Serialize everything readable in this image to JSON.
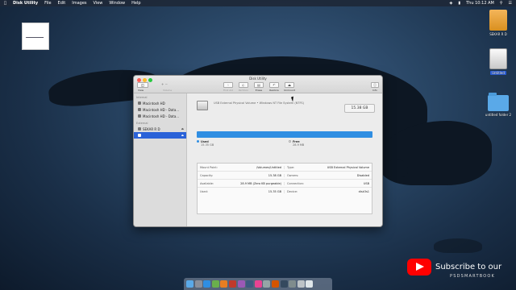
{
  "menubar": {
    "app": "Disk Utility",
    "items": [
      "File",
      "Edit",
      "Images",
      "View",
      "Window",
      "Help"
    ],
    "time": "Thu 10:12 AM"
  },
  "desktop": {
    "icons": [
      {
        "label": "SEKAR R D",
        "type": "drive-orange"
      },
      {
        "label": "Untitled",
        "type": "drive-white",
        "selected": true
      },
      {
        "label": "untitled folder 2",
        "type": "folder"
      }
    ]
  },
  "window": {
    "title": "Disk Utility",
    "toolbar": {
      "view_label": "View",
      "volume_label": "Volume",
      "tools": [
        {
          "label": "First Aid",
          "icon": "stethoscope-icon",
          "enabled": false
        },
        {
          "label": "Partition",
          "icon": "partition-icon",
          "enabled": false
        },
        {
          "label": "Erase",
          "icon": "erase-icon",
          "enabled": true
        },
        {
          "label": "Restore",
          "icon": "restore-icon",
          "enabled": true
        },
        {
          "label": "Unmount",
          "icon": "unmount-icon",
          "enabled": true
        }
      ],
      "info_label": "Info"
    },
    "sidebar": {
      "internal_heading": "Internal",
      "internal": [
        "Macintosh HD",
        "Macintosh HD - Data...",
        "Macintosh HD - Data..."
      ],
      "external_heading": "External",
      "external": [
        {
          "label": "SEKAR R D",
          "selected": false
        },
        {
          "label": "",
          "selected": true
        }
      ]
    },
    "volume": {
      "description": "USB External Physical Volume • Windows NT File System (NTFS)",
      "size": "15.38 GB",
      "used_label": "Used",
      "used_value": "15.35 GB",
      "free_label": "Free",
      "free_value": "28.9 MB",
      "used_fraction": 0.998
    },
    "info_table": [
      {
        "k1": "Mount Point:",
        "v1": "/Volumes/Untitled",
        "k2": "Type:",
        "v2": "USB External Physical Volume"
      },
      {
        "k1": "Capacity:",
        "v1": "15.38 GB",
        "k2": "Owners:",
        "v2": "Disabled"
      },
      {
        "k1": "Available:",
        "v1": "28.9 MB (Zero KB purgeable)",
        "k2": "Connection:",
        "v2": "USB"
      },
      {
        "k1": "Used:",
        "v1": "15.35 GB",
        "k2": "Device:",
        "v2": "disk3s1"
      }
    ]
  },
  "overlay": {
    "subscribe": "Subscribe to our",
    "channel": "PSDSMARTBOOK"
  },
  "colors": {
    "accent": "#2a62d8",
    "used_bar": "#2f8ee2",
    "youtube_red": "#ff0000"
  }
}
